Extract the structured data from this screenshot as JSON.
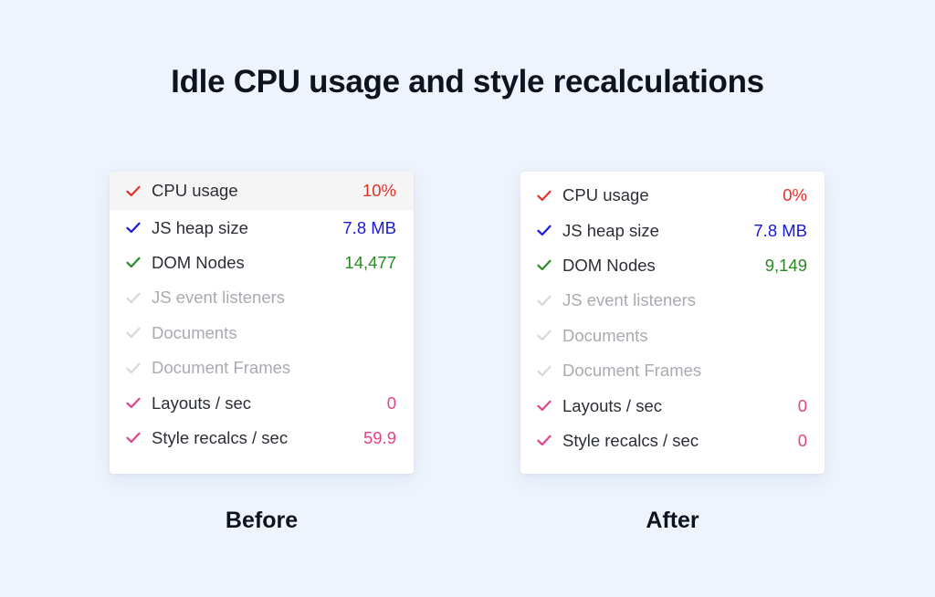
{
  "title": "Idle CPU usage and style recalculations",
  "colors": {
    "red": "#e5312a",
    "blue": "#1a1ad6",
    "green": "#2a8a25",
    "pink": "#e0438a",
    "disabled": "#d6d7db"
  },
  "before": {
    "caption": "Before",
    "rows": [
      {
        "label": "CPU usage",
        "value": "10%",
        "color": "red",
        "enabled": true,
        "icon": "check-icon"
      },
      {
        "label": "JS heap size",
        "value": "7.8 MB",
        "color": "blue",
        "enabled": true,
        "icon": "check-icon"
      },
      {
        "label": "DOM Nodes",
        "value": "14,477",
        "color": "green",
        "enabled": true,
        "icon": "check-icon"
      },
      {
        "label": "JS event listeners",
        "value": "",
        "color": "disabled",
        "enabled": false,
        "icon": "check-icon"
      },
      {
        "label": "Documents",
        "value": "",
        "color": "disabled",
        "enabled": false,
        "icon": "check-icon"
      },
      {
        "label": "Document Frames",
        "value": "",
        "color": "disabled",
        "enabled": false,
        "icon": "check-icon"
      },
      {
        "label": "Layouts / sec",
        "value": "0",
        "color": "pink",
        "enabled": true,
        "icon": "check-icon"
      },
      {
        "label": "Style recalcs / sec",
        "value": "59.9",
        "color": "pink",
        "enabled": true,
        "icon": "check-icon"
      }
    ]
  },
  "after": {
    "caption": "After",
    "rows": [
      {
        "label": "CPU usage",
        "value": "0%",
        "color": "red",
        "enabled": true,
        "icon": "check-icon"
      },
      {
        "label": "JS heap size",
        "value": "7.8 MB",
        "color": "blue",
        "enabled": true,
        "icon": "check-icon"
      },
      {
        "label": "DOM Nodes",
        "value": "9,149",
        "color": "green",
        "enabled": true,
        "icon": "check-icon"
      },
      {
        "label": "JS event listeners",
        "value": "",
        "color": "disabled",
        "enabled": false,
        "icon": "check-icon"
      },
      {
        "label": "Documents",
        "value": "",
        "color": "disabled",
        "enabled": false,
        "icon": "check-icon"
      },
      {
        "label": "Document Frames",
        "value": "",
        "color": "disabled",
        "enabled": false,
        "icon": "check-icon"
      },
      {
        "label": "Layouts / sec",
        "value": "0",
        "color": "pink",
        "enabled": true,
        "icon": "check-icon"
      },
      {
        "label": "Style recalcs / sec",
        "value": "0",
        "color": "pink",
        "enabled": true,
        "icon": "check-icon"
      }
    ]
  }
}
